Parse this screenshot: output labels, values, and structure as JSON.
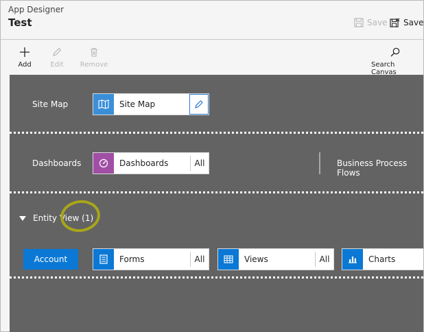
{
  "header": {
    "app_name": "App Designer",
    "app_title": "Test",
    "save_disabled_label": "Save",
    "save_label": "Save"
  },
  "toolbar": {
    "add_label": "Add",
    "edit_label": "Edit",
    "remove_label": "Remove",
    "search_label": "Search Canvas"
  },
  "canvas": {
    "site_map": {
      "row_label": "Site Map",
      "tile_label": "Site Map",
      "icon": "map-icon",
      "icon_color": "#3b8fd9"
    },
    "dashboards": {
      "row_label": "Dashboards",
      "tile_label": "Dashboards",
      "all_label": "All",
      "icon": "dashboard-icon",
      "icon_color": "#a14fa5"
    },
    "business_process_flows_label": "Business Process Flows",
    "entity_view": {
      "toggle_label": "Entity View (1)",
      "account_label": "Account",
      "forms": {
        "label": "Forms",
        "all_label": "All",
        "icon": "form-icon",
        "icon_color": "#0a78d4"
      },
      "views": {
        "label": "Views",
        "all_label": "All",
        "icon": "grid-icon",
        "icon_color": "#0a78d4"
      },
      "charts": {
        "label": "Charts",
        "icon": "chart-icon",
        "icon_color": "#0a78d4"
      }
    }
  },
  "colors": {
    "canvas_bg": "#636363",
    "accent": "#0a78d4",
    "highlight": "#a8a61a"
  }
}
